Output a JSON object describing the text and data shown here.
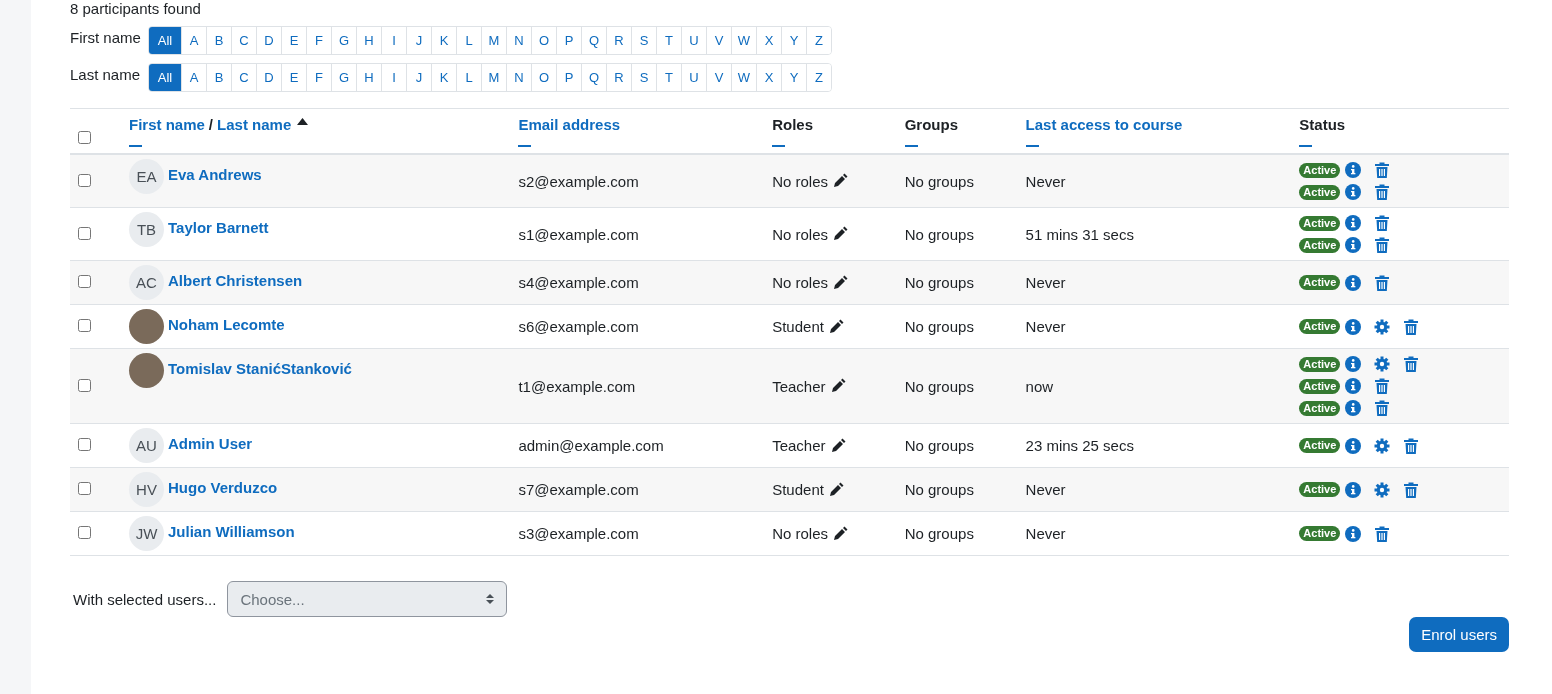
{
  "summary": "8 participants found",
  "filters": [
    {
      "label": "First name",
      "letters": [
        {
          "text": "All",
          "selected": true
        },
        {
          "text": "A",
          "selected": false
        },
        {
          "text": "B",
          "selected": false
        },
        {
          "text": "C",
          "selected": false
        },
        {
          "text": "D",
          "selected": false
        },
        {
          "text": "E",
          "selected": false
        },
        {
          "text": "F",
          "selected": false
        },
        {
          "text": "G",
          "selected": false
        },
        {
          "text": "H",
          "selected": false
        },
        {
          "text": "I",
          "selected": false
        },
        {
          "text": "J",
          "selected": false
        },
        {
          "text": "K",
          "selected": false
        },
        {
          "text": "L",
          "selected": false
        },
        {
          "text": "M",
          "selected": false
        },
        {
          "text": "N",
          "selected": false
        },
        {
          "text": "O",
          "selected": false
        },
        {
          "text": "P",
          "selected": false
        },
        {
          "text": "Q",
          "selected": false
        },
        {
          "text": "R",
          "selected": false
        },
        {
          "text": "S",
          "selected": false
        },
        {
          "text": "T",
          "selected": false
        },
        {
          "text": "U",
          "selected": false
        },
        {
          "text": "V",
          "selected": false
        },
        {
          "text": "W",
          "selected": false
        },
        {
          "text": "X",
          "selected": false
        },
        {
          "text": "Y",
          "selected": false
        },
        {
          "text": "Z",
          "selected": false
        }
      ]
    },
    {
      "label": "Last name",
      "letters": [
        {
          "text": "All",
          "selected": true
        },
        {
          "text": "A",
          "selected": false
        },
        {
          "text": "B",
          "selected": false
        },
        {
          "text": "C",
          "selected": false
        },
        {
          "text": "D",
          "selected": false
        },
        {
          "text": "E",
          "selected": false
        },
        {
          "text": "F",
          "selected": false
        },
        {
          "text": "G",
          "selected": false
        },
        {
          "text": "H",
          "selected": false
        },
        {
          "text": "I",
          "selected": false
        },
        {
          "text": "J",
          "selected": false
        },
        {
          "text": "K",
          "selected": false
        },
        {
          "text": "L",
          "selected": false
        },
        {
          "text": "M",
          "selected": false
        },
        {
          "text": "N",
          "selected": false
        },
        {
          "text": "O",
          "selected": false
        },
        {
          "text": "P",
          "selected": false
        },
        {
          "text": "Q",
          "selected": false
        },
        {
          "text": "R",
          "selected": false
        },
        {
          "text": "S",
          "selected": false
        },
        {
          "text": "T",
          "selected": false
        },
        {
          "text": "U",
          "selected": false
        },
        {
          "text": "V",
          "selected": false
        },
        {
          "text": "W",
          "selected": false
        },
        {
          "text": "X",
          "selected": false
        },
        {
          "text": "Y",
          "selected": false
        },
        {
          "text": "Z",
          "selected": false
        }
      ]
    }
  ],
  "table": {
    "select_all": {
      "checked": false
    },
    "columns": [
      {
        "parts": [
          "First name",
          "Last name"
        ],
        "separator": "/",
        "sortable": true,
        "sorted": true
      },
      {
        "parts": [
          "Email address"
        ],
        "sortable": true,
        "sorted": false
      },
      {
        "parts": [
          "Roles"
        ],
        "sortable": false,
        "sorted": false
      },
      {
        "parts": [
          "Groups"
        ],
        "sortable": false,
        "sorted": false
      },
      {
        "parts": [
          "Last access to course"
        ],
        "sortable": true,
        "sorted": false
      },
      {
        "parts": [
          "Status"
        ],
        "sortable": false,
        "sorted": false
      }
    ],
    "rows": [
      {
        "checked": false,
        "avatar": {
          "kind": "initials",
          "text": "EA"
        },
        "name": "Eva Andrews",
        "email": "s2@example.com",
        "roles": "No roles",
        "groups": "No groups",
        "last_access": "Never",
        "enrolments": [
          {
            "status": "Active",
            "settings": false
          },
          {
            "status": "Active",
            "settings": false
          }
        ]
      },
      {
        "checked": false,
        "avatar": {
          "kind": "initials",
          "text": "TB"
        },
        "name": "Taylor Barnett",
        "email": "s1@example.com",
        "roles": "No roles",
        "groups": "No groups",
        "last_access": "51 mins 31 secs",
        "enrolments": [
          {
            "status": "Active",
            "settings": false
          },
          {
            "status": "Active",
            "settings": false
          }
        ]
      },
      {
        "checked": false,
        "avatar": {
          "kind": "initials",
          "text": "AC"
        },
        "name": "Albert Christensen",
        "email": "s4@example.com",
        "roles": "No roles",
        "groups": "No groups",
        "last_access": "Never",
        "enrolments": [
          {
            "status": "Active",
            "settings": false
          }
        ]
      },
      {
        "checked": false,
        "avatar": {
          "kind": "photo"
        },
        "name": "Noham Lecomte",
        "email": "s6@example.com",
        "roles": "Student",
        "groups": "No groups",
        "last_access": "Never",
        "enrolments": [
          {
            "status": "Active",
            "settings": true
          }
        ]
      },
      {
        "checked": false,
        "avatar": {
          "kind": "photo"
        },
        "name": "Tomislav StanićStanković",
        "email": "t1@example.com",
        "roles": "Teacher",
        "groups": "No groups",
        "last_access": "now",
        "enrolments": [
          {
            "status": "Active",
            "settings": true
          },
          {
            "status": "Active",
            "settings": false
          },
          {
            "status": "Active",
            "settings": false
          }
        ]
      },
      {
        "checked": false,
        "avatar": {
          "kind": "initials",
          "text": "AU"
        },
        "name": "Admin User",
        "email": "admin@example.com",
        "roles": "Teacher",
        "groups": "No groups",
        "last_access": "23 mins 25 secs",
        "enrolments": [
          {
            "status": "Active",
            "settings": true
          }
        ]
      },
      {
        "checked": false,
        "avatar": {
          "kind": "initials",
          "text": "HV"
        },
        "name": "Hugo Verduzco",
        "email": "s7@example.com",
        "roles": "Student",
        "groups": "No groups",
        "last_access": "Never",
        "enrolments": [
          {
            "status": "Active",
            "settings": true
          }
        ]
      },
      {
        "checked": false,
        "avatar": {
          "kind": "initials",
          "text": "JW"
        },
        "name": "Julian Williamson",
        "email": "s3@example.com",
        "roles": "No roles",
        "groups": "No groups",
        "last_access": "Never",
        "enrolments": [
          {
            "status": "Active",
            "settings": false
          }
        ]
      }
    ]
  },
  "bulk_action": {
    "label": "With selected users...",
    "placeholder": "Choose..."
  },
  "enrol_button": "Enrol users"
}
